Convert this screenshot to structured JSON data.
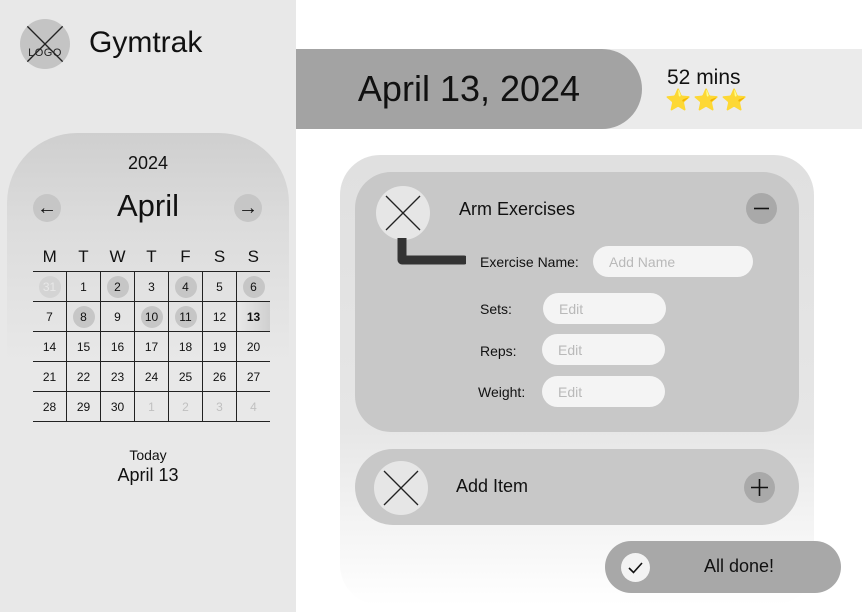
{
  "app": {
    "name": "Gymtrak",
    "logo_text": "LOGO"
  },
  "calendar": {
    "year": "2024",
    "month": "April",
    "prev_icon": "←",
    "next_icon": "→",
    "weekdays": [
      "M",
      "T",
      "W",
      "T",
      "F",
      "S",
      "S"
    ],
    "weeks": [
      [
        {
          "d": "31",
          "muted": true,
          "dot": true
        },
        {
          "d": "1"
        },
        {
          "d": "2",
          "dot": true
        },
        {
          "d": "3"
        },
        {
          "d": "4",
          "dot": true
        },
        {
          "d": "5"
        },
        {
          "d": "6",
          "dot": true
        }
      ],
      [
        {
          "d": "7"
        },
        {
          "d": "8",
          "dot": true
        },
        {
          "d": "9"
        },
        {
          "d": "10",
          "dot": true
        },
        {
          "d": "11",
          "dot": true
        },
        {
          "d": "12"
        },
        {
          "d": "13",
          "today": true
        }
      ],
      [
        {
          "d": "14"
        },
        {
          "d": "15"
        },
        {
          "d": "16"
        },
        {
          "d": "17"
        },
        {
          "d": "18"
        },
        {
          "d": "19"
        },
        {
          "d": "20"
        }
      ],
      [
        {
          "d": "21"
        },
        {
          "d": "22"
        },
        {
          "d": "23"
        },
        {
          "d": "24"
        },
        {
          "d": "25"
        },
        {
          "d": "26"
        },
        {
          "d": "27"
        }
      ],
      [
        {
          "d": "28"
        },
        {
          "d": "29"
        },
        {
          "d": "30"
        },
        {
          "d": "1",
          "muted": true
        },
        {
          "d": "2",
          "muted": true
        },
        {
          "d": "3",
          "muted": true
        },
        {
          "d": "4",
          "muted": true
        }
      ]
    ],
    "today_label": "Today",
    "today_date": "April 13"
  },
  "header": {
    "date": "April 13, 2024",
    "duration": "52 mins",
    "stars": "⭐⭐⭐",
    "rating": 3
  },
  "workout": {
    "group_title": "Arm Exercises",
    "exercise_name_label": "Exercise Name:",
    "exercise_name_placeholder": "Add Name",
    "sets_label": "Sets:",
    "sets_placeholder": "Edit",
    "reps_label": "Reps:",
    "reps_placeholder": "Edit",
    "weight_label": "Weight:",
    "weight_placeholder": "Edit",
    "add_item_label": "Add Item"
  },
  "done_label": "All done!",
  "colors": {
    "sidebar": "#e8e8e8",
    "pill": "#a3a3a3",
    "card": "#c8c8c8",
    "star": "#f2b600"
  }
}
